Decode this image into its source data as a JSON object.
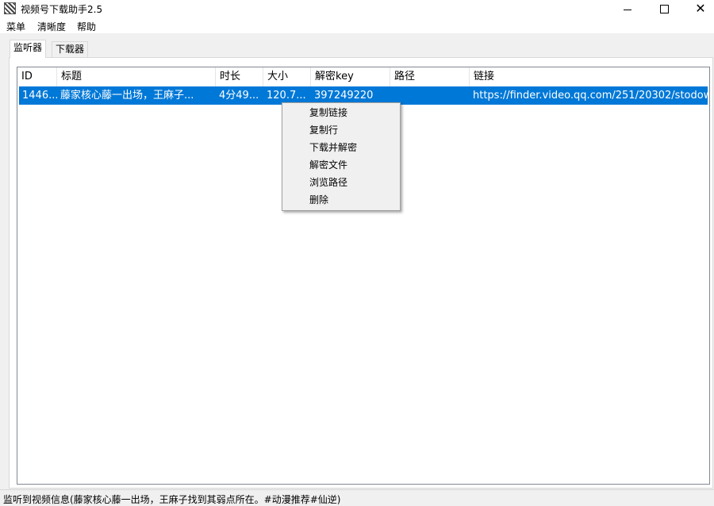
{
  "window": {
    "title": "视频号下载助手2.5",
    "minimize_glyph": "",
    "close_glyph": "✕"
  },
  "menubar": {
    "items": [
      "菜单",
      "清晰度",
      "帮助"
    ]
  },
  "tabs": [
    {
      "label": "监听器",
      "active": true
    },
    {
      "label": "下载器",
      "active": false
    }
  ],
  "table": {
    "columns": [
      "ID",
      "标题",
      "时长",
      "大小",
      "解密key",
      "路径",
      "链接"
    ],
    "rows": [
      {
        "id": "1446...",
        "title": "藤家核心藤一出场，王麻子...",
        "duration": "4分49...",
        "size": "120.7...",
        "key": "397249220",
        "path": "",
        "link": "https://finder.video.qq.com/251/20302/stodow..."
      }
    ],
    "selection_color": "#0078d7"
  },
  "context_menu": {
    "items": [
      "复制链接",
      "复制行",
      "下载并解密",
      "解密文件",
      "浏览路径",
      "删除"
    ]
  },
  "statusbar": {
    "text": "监听到视频信息(藤家核心藤一出场，王麻子找到其弱点所在。#动漫推荐#仙逆)"
  }
}
